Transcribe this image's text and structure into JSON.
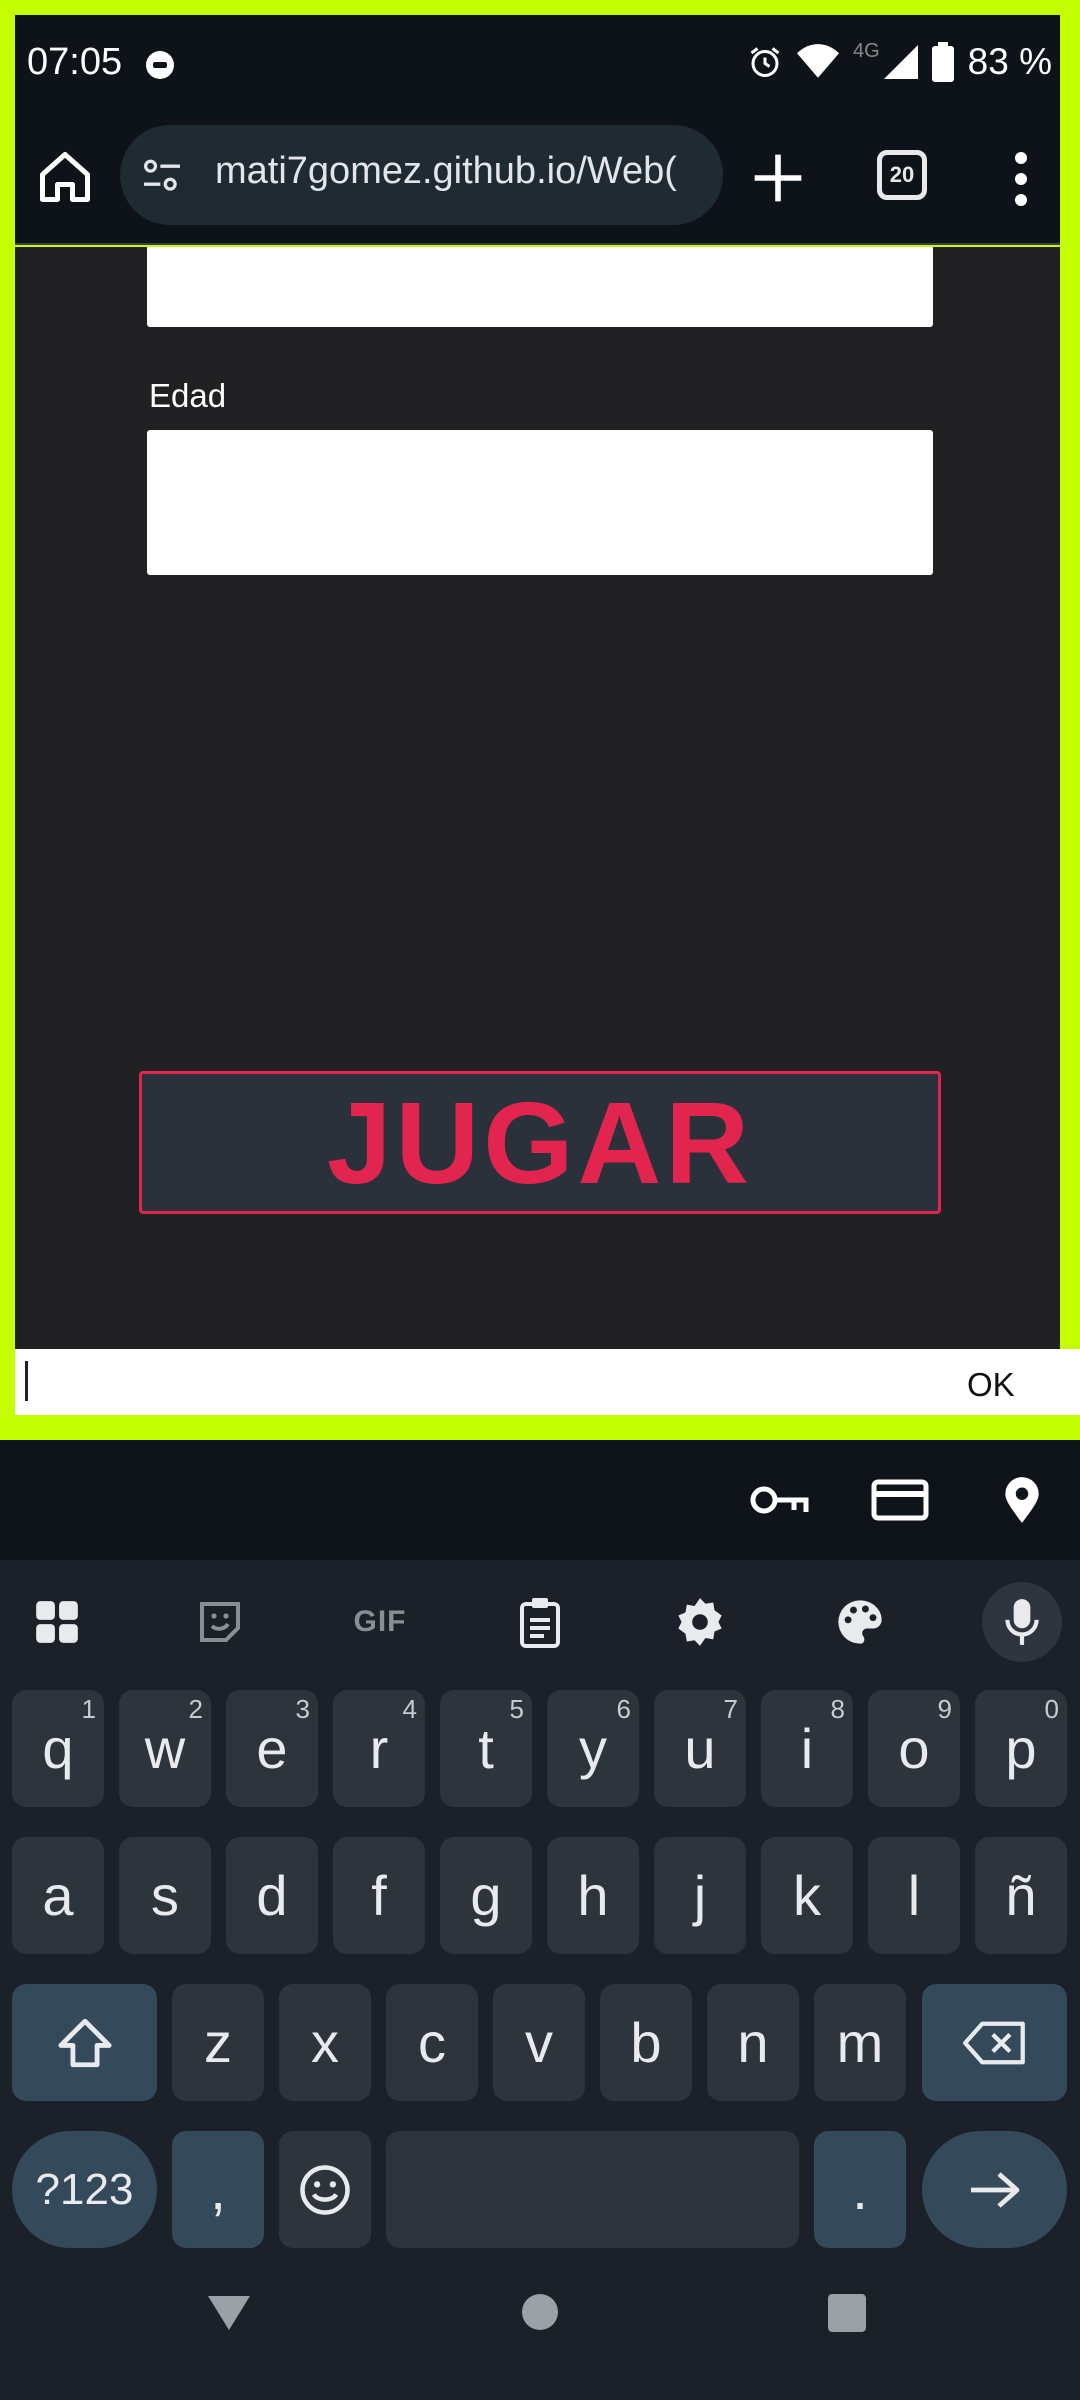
{
  "status_bar": {
    "time": "07:05",
    "network": "4G",
    "battery": "83 %"
  },
  "browser": {
    "url": "mati7gomez.github.io/Web(",
    "tab_count": "20"
  },
  "form": {
    "age_label": "Edad",
    "play_button": "JUGAR"
  },
  "prompt": {
    "ok_label": "OK"
  },
  "keyboard": {
    "tools": [
      "apps-grid-icon",
      "sticker-icon",
      "GIF",
      "clipboard-icon",
      "settings-icon",
      "palette-icon",
      "mic-icon"
    ],
    "row1": [
      {
        "k": "q",
        "h": "1"
      },
      {
        "k": "w",
        "h": "2"
      },
      {
        "k": "e",
        "h": "3"
      },
      {
        "k": "r",
        "h": "4"
      },
      {
        "k": "t",
        "h": "5"
      },
      {
        "k": "y",
        "h": "6"
      },
      {
        "k": "u",
        "h": "7"
      },
      {
        "k": "i",
        "h": "8"
      },
      {
        "k": "o",
        "h": "9"
      },
      {
        "k": "p",
        "h": "0"
      }
    ],
    "row2": [
      "a",
      "s",
      "d",
      "f",
      "g",
      "h",
      "j",
      "k",
      "l",
      "ñ"
    ],
    "row3": [
      "z",
      "x",
      "c",
      "v",
      "b",
      "n",
      "m"
    ],
    "symbols_key": "?123",
    "comma_key": ",",
    "period_key": "."
  },
  "colors": {
    "frame": "#c3ff00",
    "accent": "#e1254f",
    "page_bg": "#212124"
  }
}
